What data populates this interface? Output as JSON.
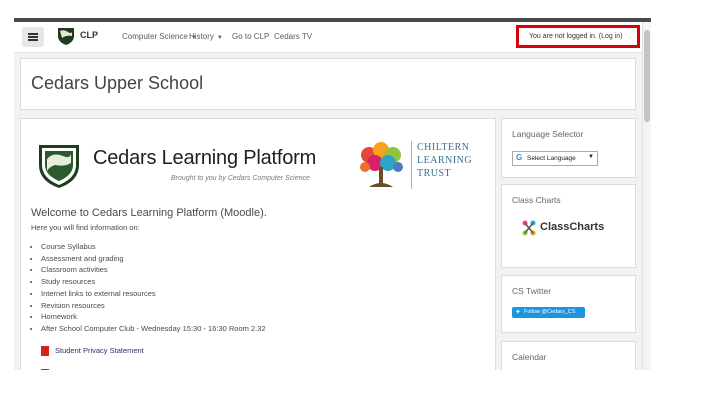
{
  "navbar": {
    "brand": "CLP",
    "links": [
      {
        "label": "Computer Science",
        "dropdown": true
      },
      {
        "label": "History",
        "dropdown": true
      },
      {
        "label": "Go to CLP",
        "dropdown": false
      },
      {
        "label": "Cedars TV",
        "dropdown": false
      }
    ],
    "login_text": "You are not logged in. (Log in)"
  },
  "page": {
    "title": "Cedars Upper School"
  },
  "banner": {
    "title": "Cedars Learning Platform",
    "subtitle": "Brought to you by Cedars Computer Science",
    "trust_line1": "CHILTERN",
    "trust_line2": "LEARNING",
    "trust_line3": "TRUST"
  },
  "welcome": {
    "heading": "Welcome to Cedars Learning Platform (Moodle).",
    "intro": "Here you will find information on:",
    "items": [
      "Course Syllabus",
      "Assessment and grading",
      "Classroom activities",
      "Study resources",
      "Internet links to external resources",
      "Revision resources",
      "Homework",
      "After School Computer Club - Wednesday 15:30 - 16:30 Room 2.32"
    ],
    "privacy_link": "Student Privacy Statement"
  },
  "sidebar": {
    "language": {
      "title": "Language Selector",
      "select_label": "Select Language"
    },
    "classcharts": {
      "title": "Class Charts",
      "logo_text": "ClassCharts"
    },
    "twitter": {
      "title": "CS Twitter",
      "button": "Follow @Cedars_CS"
    },
    "calendar": {
      "title": "Calendar"
    }
  },
  "colors": {
    "highlight": "#d7000f",
    "twitter": "#1b95e0",
    "link": "#2f2f6e"
  }
}
